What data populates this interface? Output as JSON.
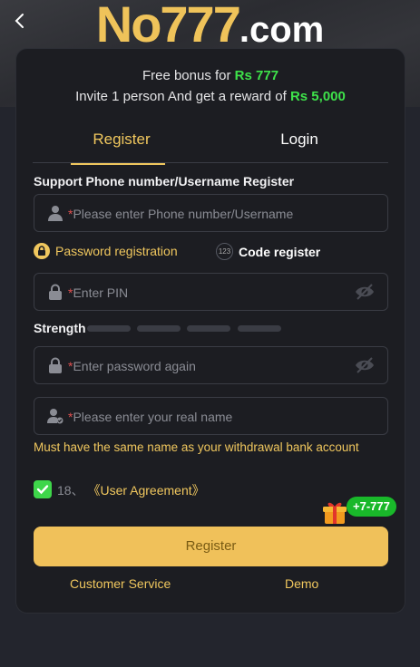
{
  "header": {
    "logo_big": "No777",
    "logo_small": ".com"
  },
  "bonus": {
    "line1_text": "Free bonus for ",
    "line1_amount": "Rs 777",
    "line2_text": "Invite 1 person And get a reward of ",
    "line2_amount": "Rs 5,000"
  },
  "tabs": [
    {
      "label": "Register",
      "active": true
    },
    {
      "label": "Login",
      "active": false
    }
  ],
  "form": {
    "support_label": "Support Phone number/Username Register",
    "phone_placeholder": "Please enter Phone number/Username",
    "password_registration_label": "Password registration",
    "code_register_badge": "123",
    "code_register_label": "Code register",
    "pin_placeholder": "Enter PIN",
    "strength_label": "Strength",
    "password_again_placeholder": "Enter password again",
    "real_name_placeholder": "Please enter your real name",
    "warning": "Must have the same name as your withdrawal bank account",
    "agreement_prefix": "18、",
    "agreement_link": "《User Agreement》",
    "agreement_checked": true,
    "reward_badge": "+7-777",
    "register_button": "Register"
  },
  "footer": {
    "customer_service": "Customer Service",
    "demo": "Demo"
  },
  "colors": {
    "accent": "#f0c75e",
    "green": "#3ee24a",
    "background": "#23252d",
    "card": "#1c1d22"
  },
  "icons": [
    "back-arrow-icon",
    "user-icon",
    "lock-icon",
    "eye-off-icon",
    "user-check-icon",
    "gift-icon",
    "check-icon"
  ]
}
